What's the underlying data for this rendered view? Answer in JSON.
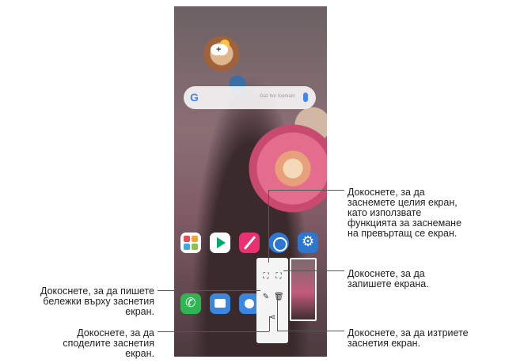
{
  "phone": {
    "search_hint": "Gaz hor Ioomam",
    "home_apps": [
      "gallery",
      "play-store",
      "pen",
      "clock",
      "settings"
    ],
    "dock_apps": [
      "phone",
      "messages",
      "camera"
    ]
  },
  "capture_tools": {
    "full_screen_icon": "capture-full-icon",
    "scroll_capture_icon": "capture-extended-icon",
    "write_icon": "pen-icon",
    "delete_icon": "trash-icon",
    "share_icon": "share-icon"
  },
  "annotations": {
    "capture_full": [
      "Докоснете, за да",
      "заснемете целия екран,",
      "като използвате",
      "функцията за заснемане",
      "на превъртащ се екран."
    ],
    "record_screen": [
      "Докоснете, за да",
      "запишете екрана."
    ],
    "write_notes": [
      "Докоснете, за да пишете",
      "бележки върху заснетия",
      "екран."
    ],
    "share": [
      "Докоснете, за да",
      "споделите заснетия",
      "екран."
    ],
    "delete": [
      "Докоснете, за да изтриете",
      "заснетия екран."
    ]
  }
}
